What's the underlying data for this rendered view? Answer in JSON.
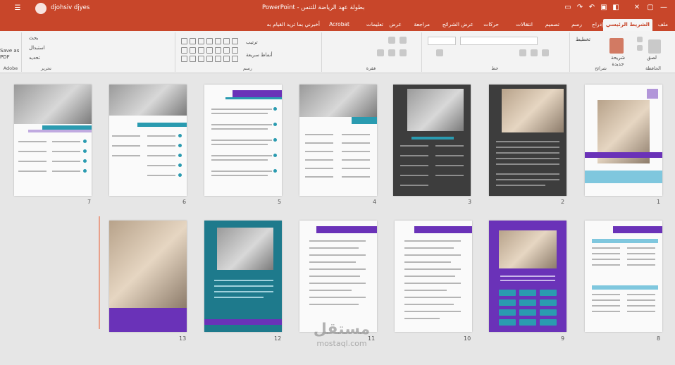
{
  "titlebar": {
    "user_name": "djohsiv djyes",
    "doc_title": "PowerPoint - بطولة عهد الرياضة للتنس",
    "app_menu_icon": "app-menu-icon",
    "window_controls": [
      "minimize",
      "maximize",
      "close"
    ]
  },
  "tabs": [
    {
      "label": "ملف"
    },
    {
      "label": "الشريط الرئيسي"
    },
    {
      "label": "إدراج"
    },
    {
      "label": "رسم"
    },
    {
      "label": "تصميم"
    },
    {
      "label": "انتقالات"
    },
    {
      "label": "حركات"
    },
    {
      "label": "عرض الشرائح"
    },
    {
      "label": "مراجعة"
    },
    {
      "label": "عرض"
    },
    {
      "label": "تعليمات"
    },
    {
      "label": "Acrobat"
    },
    {
      "label": "أخبرني بما تريد القيام به"
    }
  ],
  "ribbon": {
    "groups": [
      {
        "label": "الحافظة"
      },
      {
        "label": "شرائح"
      },
      {
        "label": "خط"
      },
      {
        "label": "فقرة"
      },
      {
        "label": "رسم"
      },
      {
        "label": "تحرير"
      },
      {
        "label": "Adobe"
      }
    ],
    "buttons": {
      "paste": "لصق",
      "new_slide": "شريحة جديدة",
      "layout": "تخطيط",
      "find": "بحث",
      "replace": "استبدال",
      "select": "تحديد",
      "save_pdf": "Save as PDF",
      "shapes": "أشكال",
      "arrange": "ترتيب",
      "quick_styles": "أنماط سريعة"
    }
  },
  "slides": [
    {
      "number": "1"
    },
    {
      "number": "2"
    },
    {
      "number": "3"
    },
    {
      "number": "4"
    },
    {
      "number": "5"
    },
    {
      "number": "6"
    },
    {
      "number": "7"
    },
    {
      "number": "8"
    },
    {
      "number": "9"
    },
    {
      "number": "10"
    },
    {
      "number": "11"
    },
    {
      "number": "12"
    },
    {
      "number": "13"
    }
  ],
  "watermark": {
    "arabic": "مستقل",
    "latin": "mostaql.com"
  },
  "colors": {
    "accent": "#c8462a",
    "purple": "#6a32b8",
    "teal": "#2a9bb0"
  }
}
